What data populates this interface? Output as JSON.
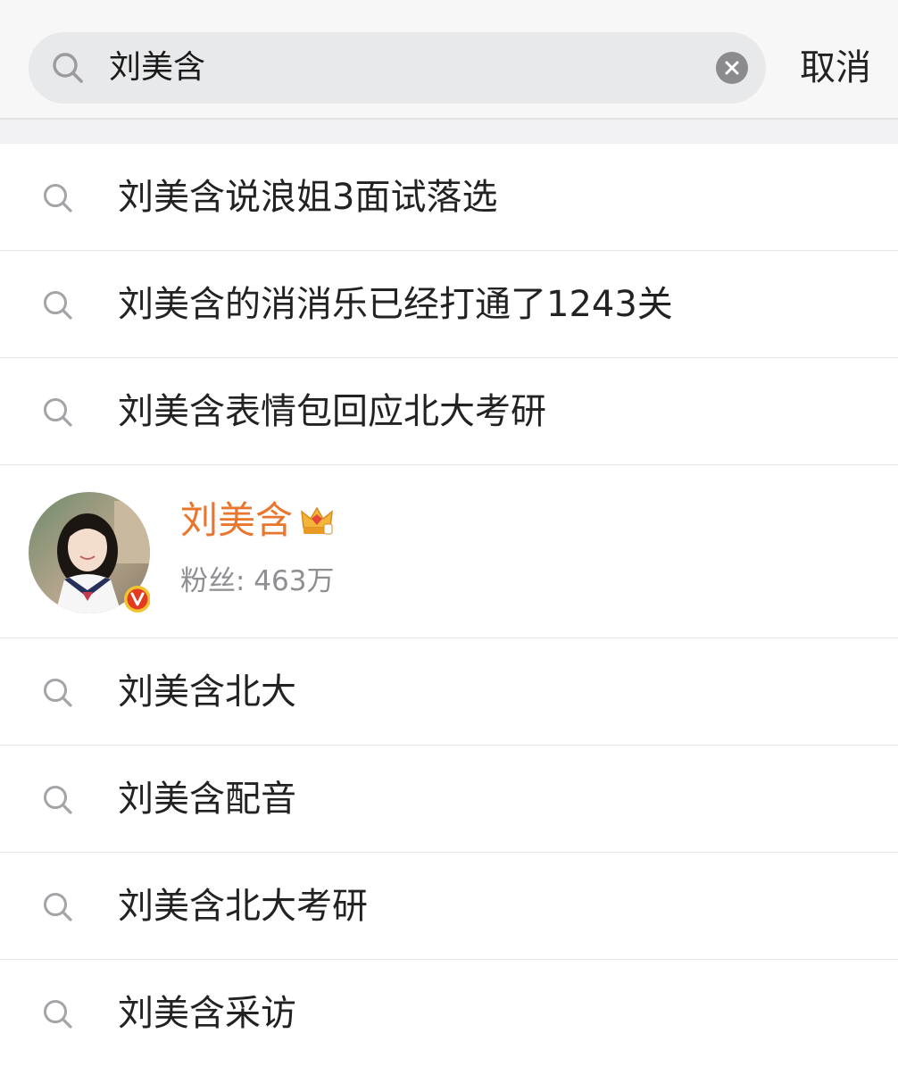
{
  "search": {
    "query": "刘美含",
    "cancel_label": "取消"
  },
  "suggestions_top": [
    {
      "text": "刘美含说浪姐3面试落选"
    },
    {
      "text": "刘美含的消消乐已经打通了1243关"
    },
    {
      "text": "刘美含表情包回应北大考研"
    }
  ],
  "user_card": {
    "name": "刘美含",
    "fans": "粉丝: 463万",
    "name_color": "#e8762d",
    "verified_icon": "verified-v-badge-icon",
    "membership_icon": "crown-vip-icon"
  },
  "suggestions_bottom": [
    {
      "text": "刘美含北大"
    },
    {
      "text": "刘美含配音"
    },
    {
      "text": "刘美含北大考研"
    },
    {
      "text": "刘美含采访"
    }
  ]
}
